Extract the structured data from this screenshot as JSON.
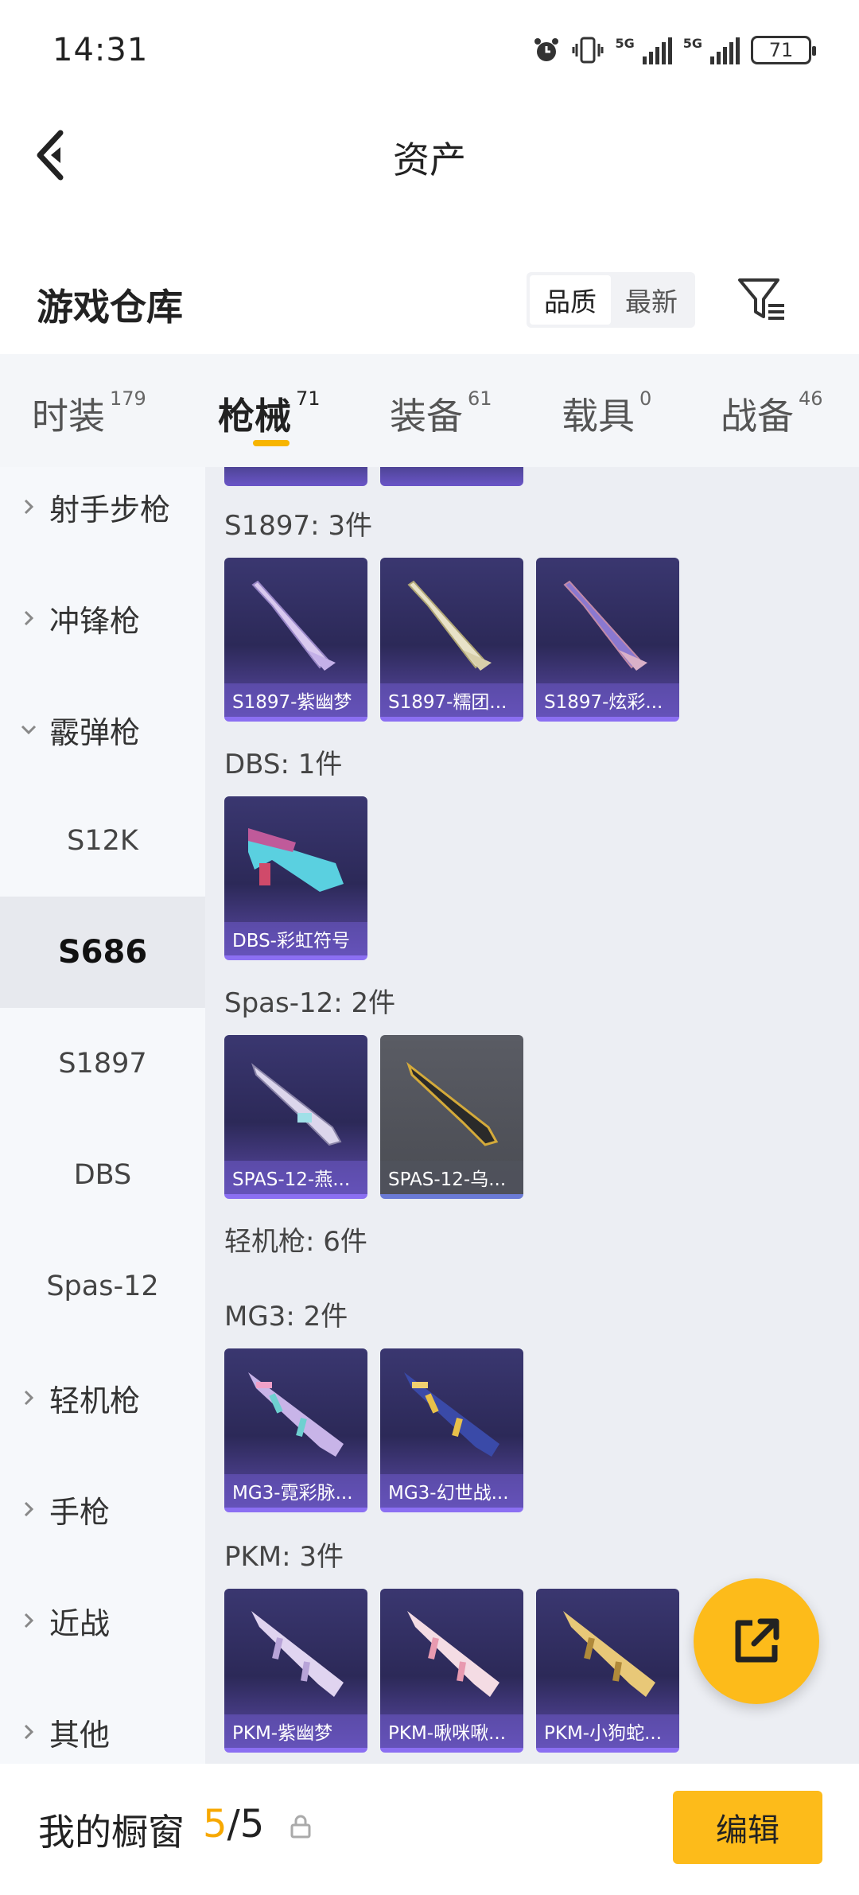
{
  "status_bar": {
    "time": "14:31",
    "net1": "5G",
    "net2": "5G",
    "battery": "71"
  },
  "header": {
    "title": "资产"
  },
  "section": {
    "title": "游戏仓库",
    "sort_options": [
      "品质",
      "最新"
    ],
    "sort_active": "品质"
  },
  "tabs": [
    {
      "label": "时装",
      "count": "179"
    },
    {
      "label": "枪械",
      "count": "71",
      "active": true
    },
    {
      "label": "装备",
      "count": "61"
    },
    {
      "label": "载具",
      "count": "0"
    },
    {
      "label": "战备",
      "count": "46"
    }
  ],
  "sidebar": {
    "categories": [
      {
        "label": "射手步枪"
      },
      {
        "label": "冲锋枪"
      },
      {
        "label": "霰弹枪",
        "expanded": true
      },
      {
        "label": "轻机枪"
      },
      {
        "label": "手枪"
      },
      {
        "label": "近战"
      },
      {
        "label": "其他"
      }
    ],
    "subs": [
      "S12K",
      "S686",
      "S1897",
      "DBS",
      "Spas-12"
    ],
    "active_sub": "S686"
  },
  "groups": [
    {
      "title": "S1897: 3件",
      "items": [
        "S1897-紫幽梦",
        "S1897-糯团...",
        "S1897-炫彩..."
      ]
    },
    {
      "title": "DBS: 1件",
      "items": [
        "DBS-彩虹符号"
      ]
    },
    {
      "title": "Spas-12: 2件",
      "items": [
        "SPAS-12-燕...",
        "SPAS-12-乌..."
      ]
    },
    {
      "title": "轻机枪: 6件"
    },
    {
      "title": "MG3: 2件",
      "items": [
        "MG3-霓彩脉...",
        "MG3-幻世战..."
      ]
    },
    {
      "title": "PKM: 3件",
      "items": [
        "PKM-紫幽梦",
        "PKM-啾咪啾...",
        "PKM-小狗蛇..."
      ]
    }
  ],
  "bottom": {
    "showcase_label": "我的橱窗",
    "showcase_current": "5",
    "showcase_sep": "/",
    "showcase_total": "5",
    "edit_label": "编辑"
  },
  "icons": {
    "back": "back-arrow-icon",
    "filter": "filter-icon",
    "share": "share-external-icon",
    "lock": "lock-icon"
  },
  "colors": {
    "accent": "#fdbb1a",
    "card_purple": "#2c2958",
    "card_grey": "#4a4c53"
  }
}
